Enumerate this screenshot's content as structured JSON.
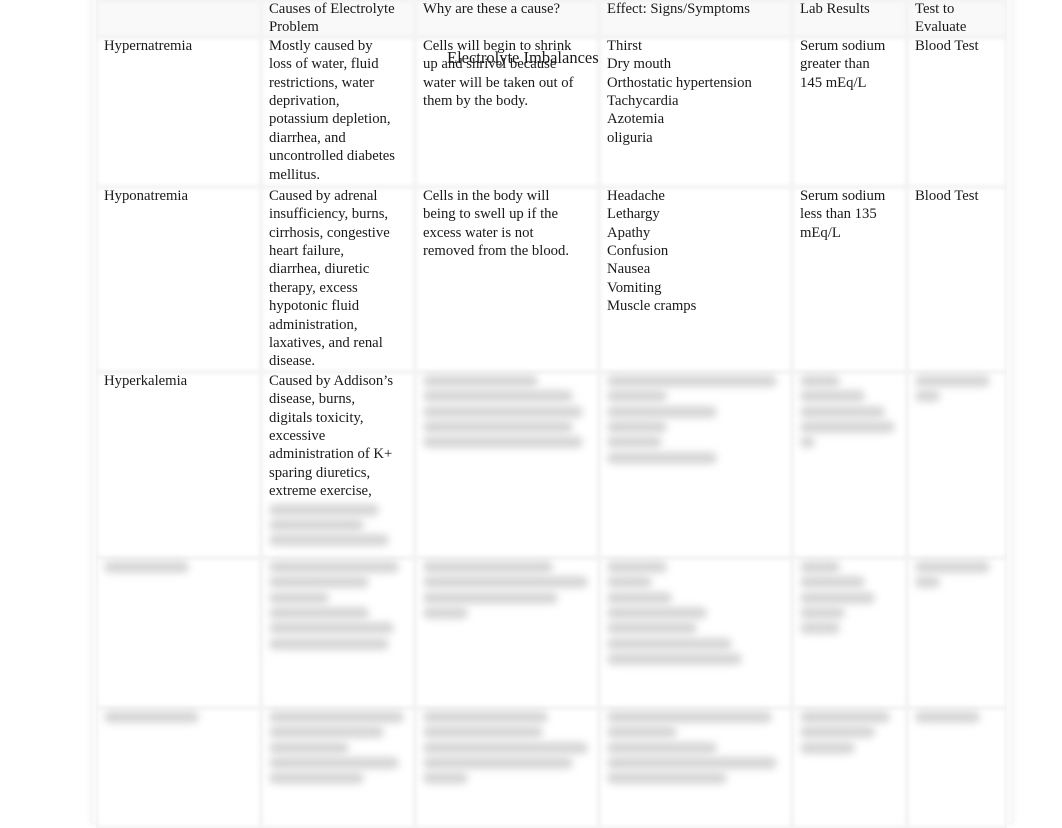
{
  "document": {
    "title": "Electrolyte Imbalances"
  },
  "table": {
    "headers": [
      "",
      "Causes of Electrolyte Problem",
      "Why are these a cause?",
      "Effect:  Signs/Symptoms",
      "Lab Results",
      "Test to Evaluate"
    ],
    "rows": [
      {
        "condition": "Hypernatremia",
        "causes": [
          "Mostly caused by",
          "loss of water, fluid",
          "restrictions, water",
          "deprivation,",
          "potassium depletion,",
          "diarrhea, and",
          "uncontrolled diabetes",
          "mellitus."
        ],
        "why": [
          "Cells will begin to shrink",
          "up and shrivel because",
          "water will be taken out of",
          "them by the body."
        ],
        "effects": [
          "Thirst",
          "Dry mouth",
          "Orthostatic hypertension",
          "Tachycardia",
          "Azotemia",
          "oliguria"
        ],
        "lab": [
          "Serum sodium",
          "greater than",
          "145 mEq/L"
        ],
        "test": "Blood Test",
        "blurred": false
      },
      {
        "condition": "Hyponatremia",
        "causes": [
          "Caused by adrenal",
          "insufficiency, burns,",
          "cirrhosis, congestive",
          "heart failure,",
          "diarrhea, diuretic",
          "therapy, excess",
          "hypotonic fluid",
          "administration,",
          "laxatives, and renal",
          "disease."
        ],
        "why": [
          "Cells in the body will",
          "being to swell up if the",
          "excess water is not",
          "removed from the blood."
        ],
        "effects": [
          "Headache",
          "Lethargy",
          "Apathy",
          "Confusion",
          "Nausea",
          "Vomiting",
          "Muscle cramps"
        ],
        "lab": [
          "Serum sodium",
          "less than 135",
          "mEq/L"
        ],
        "test": "Blood Test",
        "blurred": false
      },
      {
        "condition": "Hyperkalemia",
        "causes": [
          "Caused by Addison’s",
          "disease, burns,",
          "digitals toxicity,",
          "excessive",
          "administration of K+",
          "sparing diuretics,",
          "extreme exercise,"
        ],
        "why": [],
        "effects": [],
        "lab": [],
        "test": "",
        "blurred": "partial"
      },
      {
        "condition": "",
        "causes": [],
        "why": [],
        "effects": [],
        "lab": [],
        "test": "",
        "blurred": true
      },
      {
        "condition": "",
        "causes": [],
        "why": [],
        "effects": [],
        "lab": [],
        "test": "",
        "blurred": true
      }
    ]
  }
}
